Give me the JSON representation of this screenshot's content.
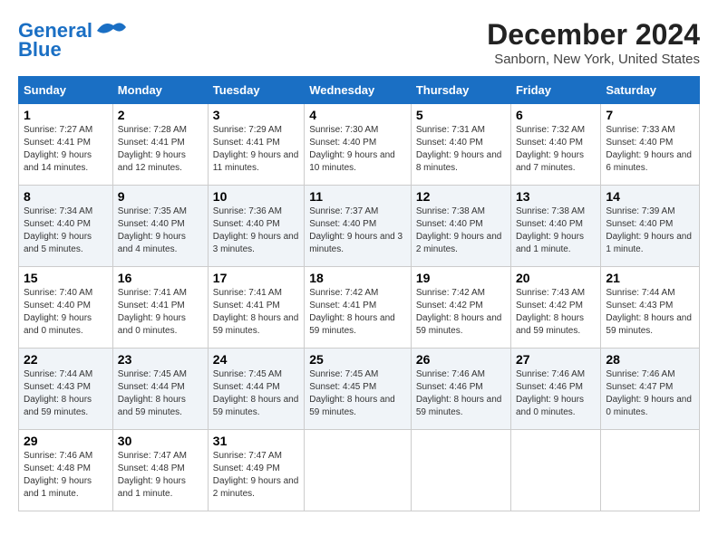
{
  "logo": {
    "line1": "General",
    "line2": "Blue"
  },
  "title": "December 2024",
  "subtitle": "Sanborn, New York, United States",
  "days_header": [
    "Sunday",
    "Monday",
    "Tuesday",
    "Wednesday",
    "Thursday",
    "Friday",
    "Saturday"
  ],
  "weeks": [
    [
      {
        "day": "1",
        "info": "Sunrise: 7:27 AM\nSunset: 4:41 PM\nDaylight: 9 hours and 14 minutes."
      },
      {
        "day": "2",
        "info": "Sunrise: 7:28 AM\nSunset: 4:41 PM\nDaylight: 9 hours and 12 minutes."
      },
      {
        "day": "3",
        "info": "Sunrise: 7:29 AM\nSunset: 4:41 PM\nDaylight: 9 hours and 11 minutes."
      },
      {
        "day": "4",
        "info": "Sunrise: 7:30 AM\nSunset: 4:40 PM\nDaylight: 9 hours and 10 minutes."
      },
      {
        "day": "5",
        "info": "Sunrise: 7:31 AM\nSunset: 4:40 PM\nDaylight: 9 hours and 8 minutes."
      },
      {
        "day": "6",
        "info": "Sunrise: 7:32 AM\nSunset: 4:40 PM\nDaylight: 9 hours and 7 minutes."
      },
      {
        "day": "7",
        "info": "Sunrise: 7:33 AM\nSunset: 4:40 PM\nDaylight: 9 hours and 6 minutes."
      }
    ],
    [
      {
        "day": "8",
        "info": "Sunrise: 7:34 AM\nSunset: 4:40 PM\nDaylight: 9 hours and 5 minutes."
      },
      {
        "day": "9",
        "info": "Sunrise: 7:35 AM\nSunset: 4:40 PM\nDaylight: 9 hours and 4 minutes."
      },
      {
        "day": "10",
        "info": "Sunrise: 7:36 AM\nSunset: 4:40 PM\nDaylight: 9 hours and 3 minutes."
      },
      {
        "day": "11",
        "info": "Sunrise: 7:37 AM\nSunset: 4:40 PM\nDaylight: 9 hours and 3 minutes."
      },
      {
        "day": "12",
        "info": "Sunrise: 7:38 AM\nSunset: 4:40 PM\nDaylight: 9 hours and 2 minutes."
      },
      {
        "day": "13",
        "info": "Sunrise: 7:38 AM\nSunset: 4:40 PM\nDaylight: 9 hours and 1 minute."
      },
      {
        "day": "14",
        "info": "Sunrise: 7:39 AM\nSunset: 4:40 PM\nDaylight: 9 hours and 1 minute."
      }
    ],
    [
      {
        "day": "15",
        "info": "Sunrise: 7:40 AM\nSunset: 4:40 PM\nDaylight: 9 hours and 0 minutes."
      },
      {
        "day": "16",
        "info": "Sunrise: 7:41 AM\nSunset: 4:41 PM\nDaylight: 9 hours and 0 minutes."
      },
      {
        "day": "17",
        "info": "Sunrise: 7:41 AM\nSunset: 4:41 PM\nDaylight: 8 hours and 59 minutes."
      },
      {
        "day": "18",
        "info": "Sunrise: 7:42 AM\nSunset: 4:41 PM\nDaylight: 8 hours and 59 minutes."
      },
      {
        "day": "19",
        "info": "Sunrise: 7:42 AM\nSunset: 4:42 PM\nDaylight: 8 hours and 59 minutes."
      },
      {
        "day": "20",
        "info": "Sunrise: 7:43 AM\nSunset: 4:42 PM\nDaylight: 8 hours and 59 minutes."
      },
      {
        "day": "21",
        "info": "Sunrise: 7:44 AM\nSunset: 4:43 PM\nDaylight: 8 hours and 59 minutes."
      }
    ],
    [
      {
        "day": "22",
        "info": "Sunrise: 7:44 AM\nSunset: 4:43 PM\nDaylight: 8 hours and 59 minutes."
      },
      {
        "day": "23",
        "info": "Sunrise: 7:45 AM\nSunset: 4:44 PM\nDaylight: 8 hours and 59 minutes."
      },
      {
        "day": "24",
        "info": "Sunrise: 7:45 AM\nSunset: 4:44 PM\nDaylight: 8 hours and 59 minutes."
      },
      {
        "day": "25",
        "info": "Sunrise: 7:45 AM\nSunset: 4:45 PM\nDaylight: 8 hours and 59 minutes."
      },
      {
        "day": "26",
        "info": "Sunrise: 7:46 AM\nSunset: 4:46 PM\nDaylight: 8 hours and 59 minutes."
      },
      {
        "day": "27",
        "info": "Sunrise: 7:46 AM\nSunset: 4:46 PM\nDaylight: 9 hours and 0 minutes."
      },
      {
        "day": "28",
        "info": "Sunrise: 7:46 AM\nSunset: 4:47 PM\nDaylight: 9 hours and 0 minutes."
      }
    ],
    [
      {
        "day": "29",
        "info": "Sunrise: 7:46 AM\nSunset: 4:48 PM\nDaylight: 9 hours and 1 minute."
      },
      {
        "day": "30",
        "info": "Sunrise: 7:47 AM\nSunset: 4:48 PM\nDaylight: 9 hours and 1 minute."
      },
      {
        "day": "31",
        "info": "Sunrise: 7:47 AM\nSunset: 4:49 PM\nDaylight: 9 hours and 2 minutes."
      },
      null,
      null,
      null,
      null
    ]
  ]
}
